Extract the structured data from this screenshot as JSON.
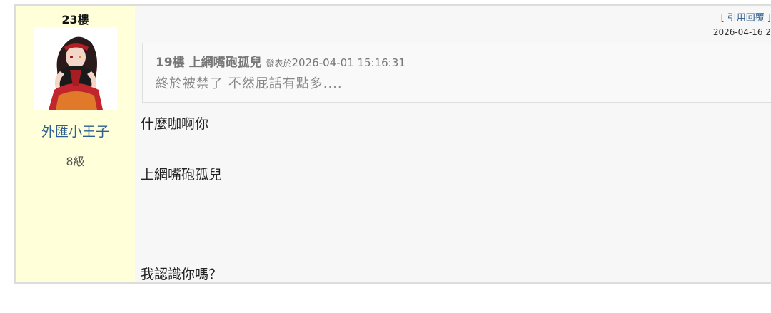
{
  "post": {
    "floor": "23樓",
    "username": "外匯小王子",
    "level": "8級",
    "quote_reply_label": "[ 引用回覆 ]",
    "timestamp": "2026-04-16 2",
    "quote": {
      "author": "19樓 上網嘴砲孤兒",
      "posted_label": "發表於",
      "posted_time": "2026-04-01 15:16:31",
      "body": "終於被禁了 不然屁話有點多...."
    },
    "lines": [
      "什麼咖啊你",
      "上網嘴砲孤兒",
      "我認識你嗎？"
    ]
  },
  "colors": {
    "sidebar_bg": "#ffffd9",
    "username": "#2f5f8f",
    "link": "#2f5f8f"
  }
}
